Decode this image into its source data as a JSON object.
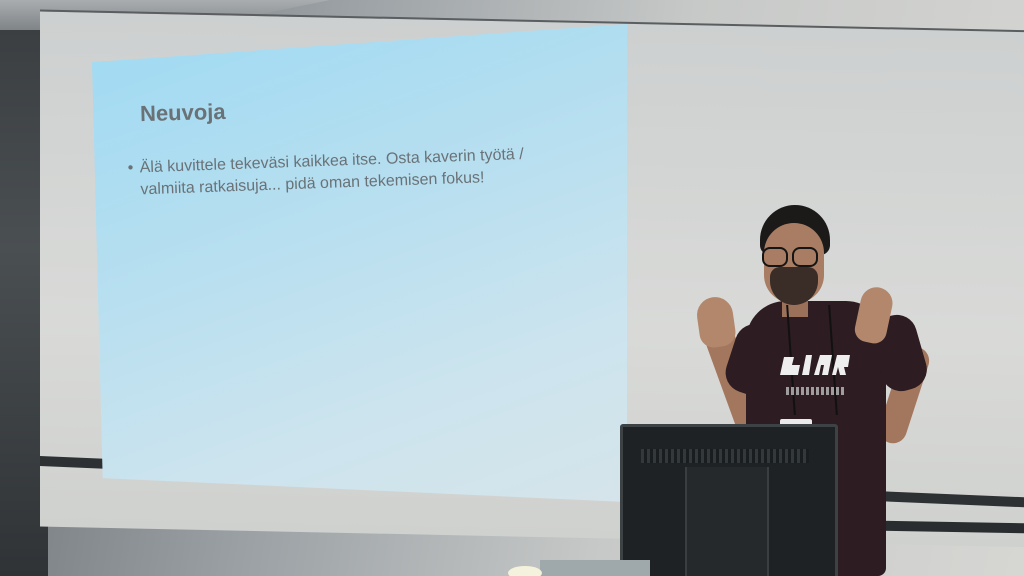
{
  "slide": {
    "title": "Neuvoja",
    "bullets": [
      {
        "symbol": "•",
        "text": "Älä kuvittele tekeväsi kaikkea itse. Osta kaverin työtä / valmiita ratkaisuja... pidä oman tekemisen fokus!"
      }
    ]
  },
  "colors": {
    "slide_background": "#b3def0",
    "slide_text": "#6a7277",
    "presenter_shirt": "#2d1c21"
  },
  "icons": {
    "shirt_logo": "shirt-print-logo-icon",
    "monitor": "monitor-icon"
  }
}
